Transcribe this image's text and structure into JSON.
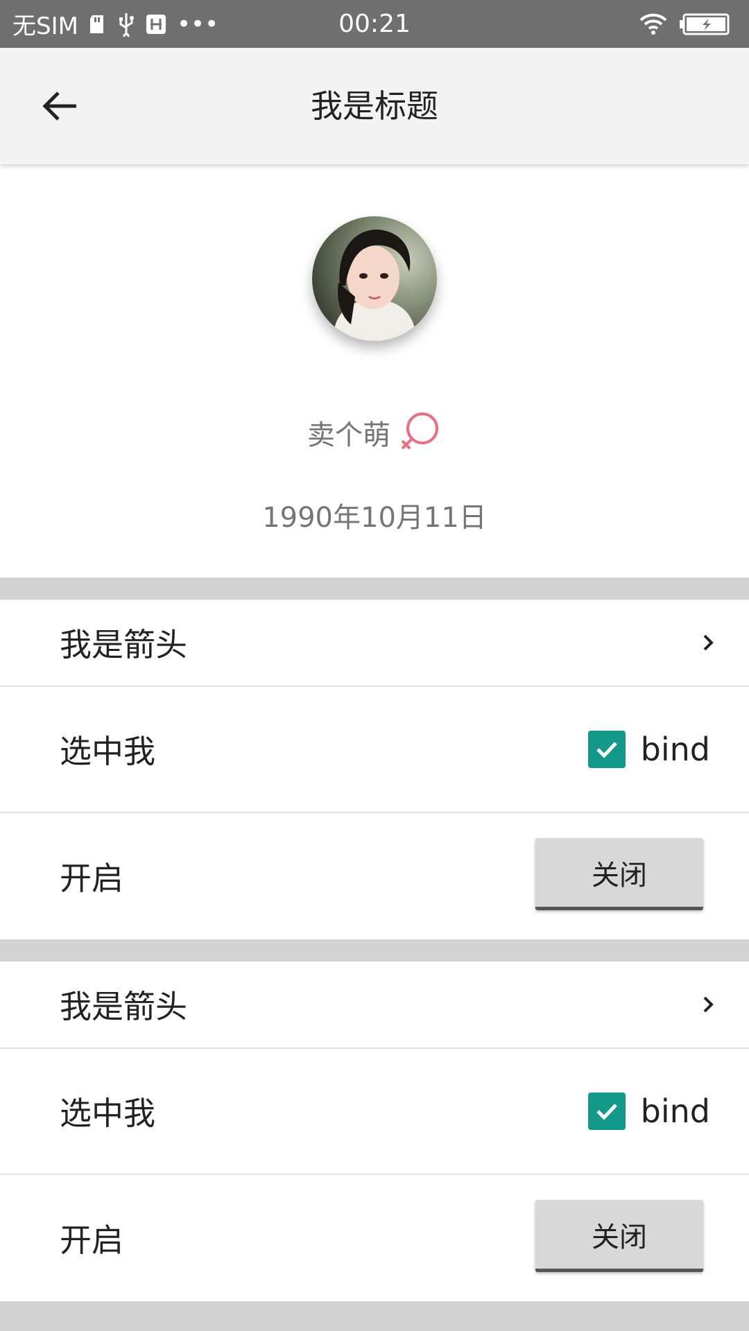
{
  "status_bar": {
    "carrier": "无SIM",
    "time": "00:21",
    "more": "•••"
  },
  "app_bar": {
    "title": "我是标题"
  },
  "profile": {
    "name": "卖个萌",
    "birthday": "1990年10月11日",
    "gender_icon": "female-icon",
    "gender_color": "#f06a80"
  },
  "sections": [
    {
      "arrow_row": {
        "label": "我是箭头"
      },
      "checkbox_row": {
        "label": "选中我",
        "checkbox_text": "bind",
        "checked": true
      },
      "toggle_row": {
        "label": "开启",
        "button_label": "关闭"
      }
    },
    {
      "arrow_row": {
        "label": "我是箭头"
      },
      "checkbox_row": {
        "label": "选中我",
        "checkbox_text": "bind",
        "checked": true
      },
      "toggle_row": {
        "label": "开启",
        "button_label": "关闭"
      }
    }
  ],
  "colors": {
    "status_bar": "#6f6f6f",
    "app_bar": "#f3f3f3",
    "divider_band": "#d3d3d3",
    "checkbox_accent": "#12998a",
    "secondary_text": "#757575"
  }
}
